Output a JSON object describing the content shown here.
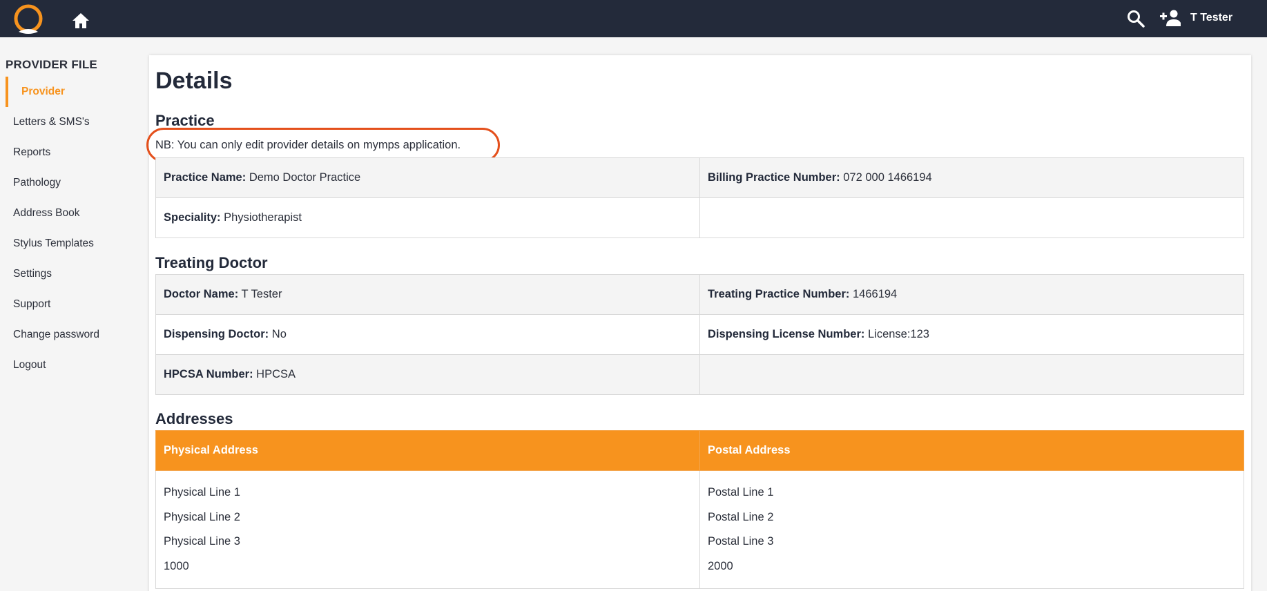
{
  "topbar": {
    "user_name": "T Tester",
    "brand_color": "#f7931e",
    "icons": [
      "logo-icon",
      "home-icon",
      "search-icon",
      "add-user-icon"
    ]
  },
  "sidebar": {
    "title": "PROVIDER FILE",
    "items": [
      {
        "label": "Provider",
        "active": true
      },
      {
        "label": "Letters & SMS's",
        "active": false
      },
      {
        "label": "Reports",
        "active": false
      },
      {
        "label": "Pathology",
        "active": false
      },
      {
        "label": "Address Book",
        "active": false
      },
      {
        "label": "Stylus Templates",
        "active": false
      },
      {
        "label": "Settings",
        "active": false
      },
      {
        "label": "Support",
        "active": false
      },
      {
        "label": "Change password",
        "active": false
      },
      {
        "label": "Logout",
        "active": false
      }
    ]
  },
  "main": {
    "title": "Details",
    "practice": {
      "heading": "Practice",
      "note": "NB: You can only edit provider details on mymps application.",
      "practice_name_label": "Practice Name:",
      "practice_name": "Demo Doctor Practice",
      "billing_number_label": "Billing Practice Number:",
      "billing_number": "072 000 1466194",
      "speciality_label": "Speciality:",
      "speciality": "Physiotherapist"
    },
    "treating_doctor": {
      "heading": "Treating Doctor",
      "doctor_name_label": "Doctor Name:",
      "doctor_name": "T Tester",
      "treating_number_label": "Treating Practice Number:",
      "treating_number": "1466194",
      "dispensing_label": "Dispensing Doctor:",
      "dispensing": "No",
      "license_label": "Dispensing License Number:",
      "license": "License:123",
      "hpcsa_label": "HPCSA Number:",
      "hpcsa": "HPCSA"
    },
    "addresses": {
      "heading": "Addresses",
      "physical_header": "Physical Address",
      "postal_header": "Postal Address",
      "physical": [
        "Physical Line 1",
        "Physical Line 2",
        "Physical Line 3",
        "1000"
      ],
      "postal": [
        "Postal Line 1",
        "Postal Line 2",
        "Postal Line 3",
        "2000"
      ]
    }
  }
}
